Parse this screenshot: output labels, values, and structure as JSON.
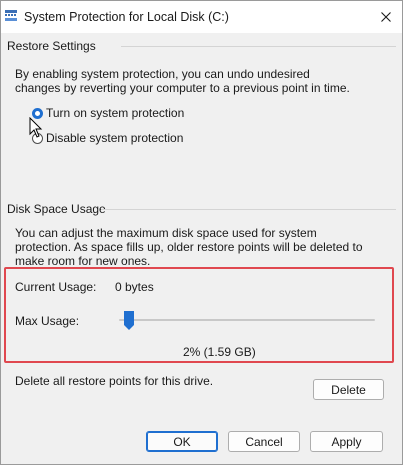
{
  "window": {
    "title": "System Protection for Local Disk (C:)",
    "close_icon": "close-icon"
  },
  "restore_settings": {
    "group_label": "Restore Settings",
    "description": "By enabling system protection, you can undo undesired changes by reverting your computer to a previous point in time.",
    "options": [
      {
        "label": "Turn on system protection",
        "selected": true
      },
      {
        "label": "Disable system protection",
        "selected": false
      }
    ]
  },
  "disk_space_usage": {
    "group_label": "Disk Space Usage",
    "description": "You can adjust the maximum disk space used for system protection. As space fills up, older restore points will be deleted to make room for new ones.",
    "current_usage_label": "Current Usage:",
    "current_usage_value": "0 bytes",
    "max_usage_label": "Max Usage:",
    "max_usage_value": "2% (1.59 GB)",
    "max_usage_percent": 2,
    "delete_description": "Delete all restore points for this drive.",
    "delete_button": "Delete"
  },
  "footer": {
    "ok_label": "OK",
    "cancel_label": "Cancel",
    "apply_label": "Apply"
  },
  "colors": {
    "accent": "#1f6fd0",
    "highlight_border": "#e0484f"
  }
}
